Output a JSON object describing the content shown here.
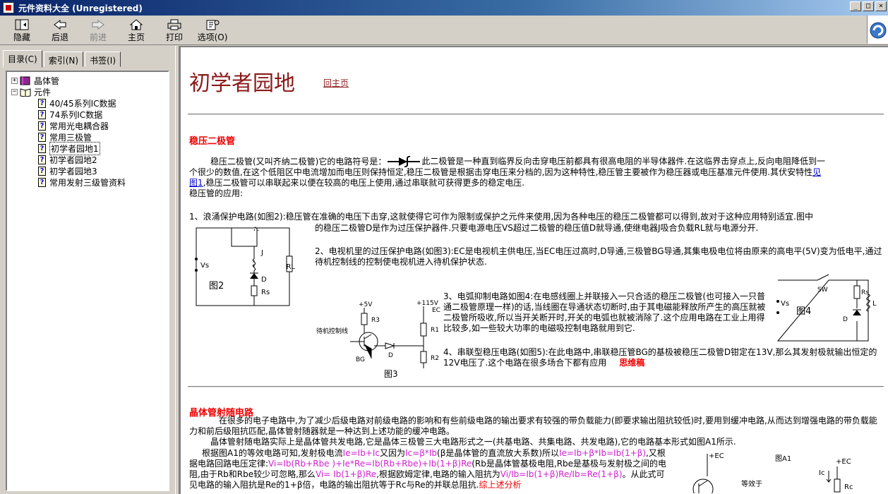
{
  "window": {
    "title": "元件资料大全 (Unregistered)"
  },
  "toolbar": {
    "buttons": [
      {
        "label": "隐藏",
        "icon": "hide-icon"
      },
      {
        "label": "后退",
        "icon": "back-arrow-icon"
      },
      {
        "label": "前进",
        "icon": "forward-arrow-icon"
      },
      {
        "label": "主页",
        "icon": "home-icon"
      },
      {
        "label": "打印",
        "icon": "printer-icon"
      },
      {
        "label": "选项(O)",
        "icon": "options-icon"
      }
    ]
  },
  "nav": {
    "tabs": [
      "目录(C)",
      "索引(N)",
      "书签(I)"
    ],
    "tree": [
      {
        "label": "晶体管",
        "type": "book",
        "expander": "+"
      },
      {
        "label": "元件",
        "type": "book-open",
        "expander": "−"
      },
      {
        "label": "40/45系列IC数据",
        "type": "page"
      },
      {
        "label": "74系列IC数据",
        "type": "page"
      },
      {
        "label": "常用光电耦合器",
        "type": "page"
      },
      {
        "label": "常用三极管",
        "type": "page"
      },
      {
        "label": "初学者园地1",
        "type": "page",
        "selected": true
      },
      {
        "label": "初学者园地2",
        "type": "page"
      },
      {
        "label": "初学者园地3",
        "type": "page"
      },
      {
        "label": "常用发射三级管资料",
        "type": "page"
      }
    ]
  },
  "content": {
    "title": "初学者园地",
    "home_link": "回主页",
    "sec1": {
      "heading": "稳压二极管",
      "intro_a": "稳压二极管(又叫齐纳二极管)它的电路符号是：",
      "intro_b": "此二极管是一种直到临界反向击穿电压前都具有很高电阻的半导体器件.在这临界击穿点上,反向电阻降低到一",
      "intro_c": "个很少的数值,在这个低阻区中电流增加而电压则保持恒定,稳压二极管是根据击穿电压来分档的,因为这种特性,稳压管主要被作为稳压器或电压基准元件使用.其伏安特性",
      "intro_link": "见",
      "intro_link2": "图1",
      "intro_d": ",稳压二极管可以串联起来以便在较高的电压上使用,通过串联就可获得更多的稳定电压.",
      "app": "稳压管的应用:",
      "item1a": "1、浪涌保护电路(如图2):稳压管在准确的电压下击穿,这就使得它可作为限制或保护之元件来使用,因为各种电压的稳压二极管都可以得到,故对于这种应用特别适宜.图中",
      "item1b": "的稳压二极管D是作为过压保护器件.只要电源电压VS超过二极管的稳压值D就导通,使继电器J吸合负载RL就与电源分开.",
      "item2": "2、电视机里的过压保护电路(如图3):EC是电视机主供电压,当EC电压过高时,D导通,三极管BG导通,其集电极电位将由原来的高电平(5V)变为低电平,通过待机控制线的控制使电视机进入待机保护状态.",
      "item3": "3、电弧抑制电路如图4:在电感线圈上并联接入一只合适的稳压二极管(也可接入一只普通二极管原理一样)的话,当线圈在导通状态切断时,由于其电磁能释放所产生的高压就被二极管所吸收,所以当开关断开时,开关的电弧也就被消除了.这个应用电路在工业上用得比较多,如一些较大功率的电磁吸控制电路就用到它.",
      "item4": "4、串联型稳压电路(如图5):在此电路中,串联稳压管BG的基极被稳压二极管D钳定在13V,那么其发射极就输出恒定的12V电压了.这个电路在很多场合下都有应用",
      "mindmap": "思维稿"
    },
    "sec2": {
      "heading": "晶体管射随电路",
      "p1": "在很多的电子电路中,为了减少后级电路对前级电路的影响和有些前级电路的输出要求有较强的带负载能力(即要求输出阻抗较低)时,要用到缓冲电路,从而达到增强电路的带负载能力和前后级阻抗匹配,晶体管射随器就是一种达到上述功能的缓冲电路。",
      "p2": "晶体管射随电路实际上是晶体管共发电路,它是晶体三极管三大电路形式之一(共基电路、共集电路、共发电路),它的电路基本形式如图A1所示.",
      "p3_a": "根据图A1的等效电路可知,发射极电流",
      "p3_f1": "Ie=Ib+Ic",
      "p3_b": "又因为",
      "p3_f2": "Ic=β*Ib",
      "p3_c": "(β是晶体管的直流放大系数)所以",
      "p3_f3": "Ie=Ib+β*Ib=Ib(1+β)",
      "p3_d": ",又根据电路回路电压定律:",
      "p3_f4": "Vi=Ib(Rb+Rbe )+Ie*Re=Ib(Rb+Rbe)+Ib(1+β)Re",
      "p3_e": "(Rb是晶体管基极电阻,Rbe是基极与发射极之间的电阻,由于Rb和Rbe较少可忽略,那么",
      "p3_f5": "Vi= Ib(1+β)Re",
      "p3_g": ",根据欧姆定律,电路的输入阻抗为",
      "p3_f6": "Vi/Ib=Ib(1+β)Re/Ib=Re(1+β)",
      "p3_h": "。从此式可见电路的输入阻抗是Re的1+β倍，电路的输出阻抗等于Rc与Re的并联总阻抗.",
      "p3_i": "综上述分析"
    },
    "fig2": {
      "label": "图2",
      "vs": "Vs",
      "j": "J",
      "d": "D",
      "rs": "Rs",
      "rl": "RL"
    },
    "fig3": {
      "label": "图3",
      "v1": "+5V",
      "v2": "+115V",
      "ec": "EC",
      "r3": "R3",
      "r1": "R1",
      "r2": "R2",
      "bg": "BG",
      "d": "D",
      "ctrl": "待机控制线"
    },
    "fig4": {
      "label": "图4",
      "vs": "Vs",
      "sw": "SW",
      "rs": "Rs",
      "l": "L",
      "d": "D"
    },
    "figA1": {
      "label": "图A1",
      "ec": "+EC",
      "ec2": "+EC",
      "eq": "等效于",
      "ic": "Ic",
      "rc": "Rc"
    }
  }
}
